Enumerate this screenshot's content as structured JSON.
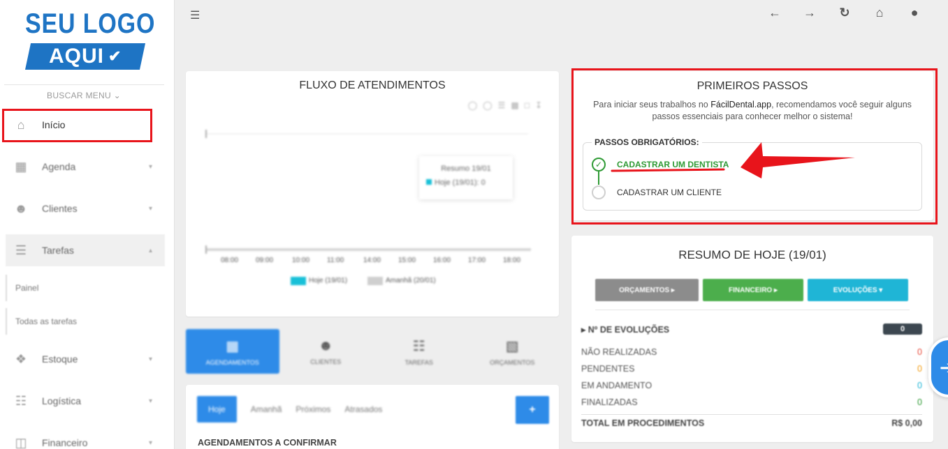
{
  "logo": {
    "line1": "SEU LOGO",
    "line2": "AQUI"
  },
  "sidebar": {
    "search_label": "BUSCAR MENU ⌄",
    "items": [
      {
        "label": "Início",
        "icon": "home-icon"
      },
      {
        "label": "Agenda",
        "icon": "calendar-icon"
      },
      {
        "label": "Clientes",
        "icon": "users-icon"
      },
      {
        "label": "Tarefas",
        "icon": "tasks-icon"
      },
      {
        "label": "Estoque",
        "icon": "boxes-icon"
      },
      {
        "label": "Logística",
        "icon": "sitemap-icon"
      },
      {
        "label": "Financeiro",
        "icon": "money-icon"
      }
    ],
    "subitems": [
      "Painel",
      "Todas as tarefas"
    ]
  },
  "chart_card": {
    "title": "FLUXO DE ATENDIMENTOS",
    "tooltip_title": "Resumo 19/01",
    "tooltip_line": "Hoje (19/01): 0",
    "legend": [
      "Hoje (19/01)",
      "Amanhã (20/01)"
    ]
  },
  "tabs": [
    "AGENDAMENTOS",
    "CLIENTES",
    "TAREFAS",
    "ORÇAMENTOS"
  ],
  "lower_card": {
    "filters": [
      "Hoje",
      "Amanhã",
      "Próximos",
      "Atrasados"
    ],
    "subtitle": "AGENDAMENTOS A CONFIRMAR"
  },
  "steps": {
    "title": "PRIMEIROS PASSOS",
    "intro_prefix": "Para iniciar seus trabalhos no ",
    "app_name": "FácilDental.app",
    "intro_suffix": ", recomendamos você seguir alguns passos essenciais para conhecer melhor o sistema!",
    "legend": "PASSOS OBRIGATÓRIOS:",
    "items": [
      {
        "label": "CADASTRAR UM DENTISTA",
        "done": true
      },
      {
        "label": "CADASTRAR UM CLIENTE",
        "done": false
      }
    ]
  },
  "summary": {
    "title": "RESUMO DE HOJE (19/01)",
    "buttons": [
      "ORÇAMENTOS ▸",
      "FINANCEIRO ▸",
      "EVOLUÇÕES ▾"
    ],
    "evolucoes_label": "▸ Nº DE EVOLUÇÕES",
    "evolucoes_count": "0",
    "rows": [
      {
        "label": "NÃO REALIZADAS",
        "value": "0",
        "color": "#e74c3c"
      },
      {
        "label": "PENDENTES",
        "value": "0",
        "color": "#f39c12"
      },
      {
        "label": "EM ANDAMENTO",
        "value": "0",
        "color": "#1fb5d6"
      },
      {
        "label": "FINALIZADAS",
        "value": "0",
        "color": "#2e9a34"
      }
    ],
    "total_label": "TOTAL EM PROCEDIMENTOS",
    "total_value": "R$ 0,00"
  },
  "colors": {
    "brand": "#1e74c4",
    "accent": "#2e8be8",
    "highlight": "#e8141b",
    "success": "#2e9a34"
  }
}
